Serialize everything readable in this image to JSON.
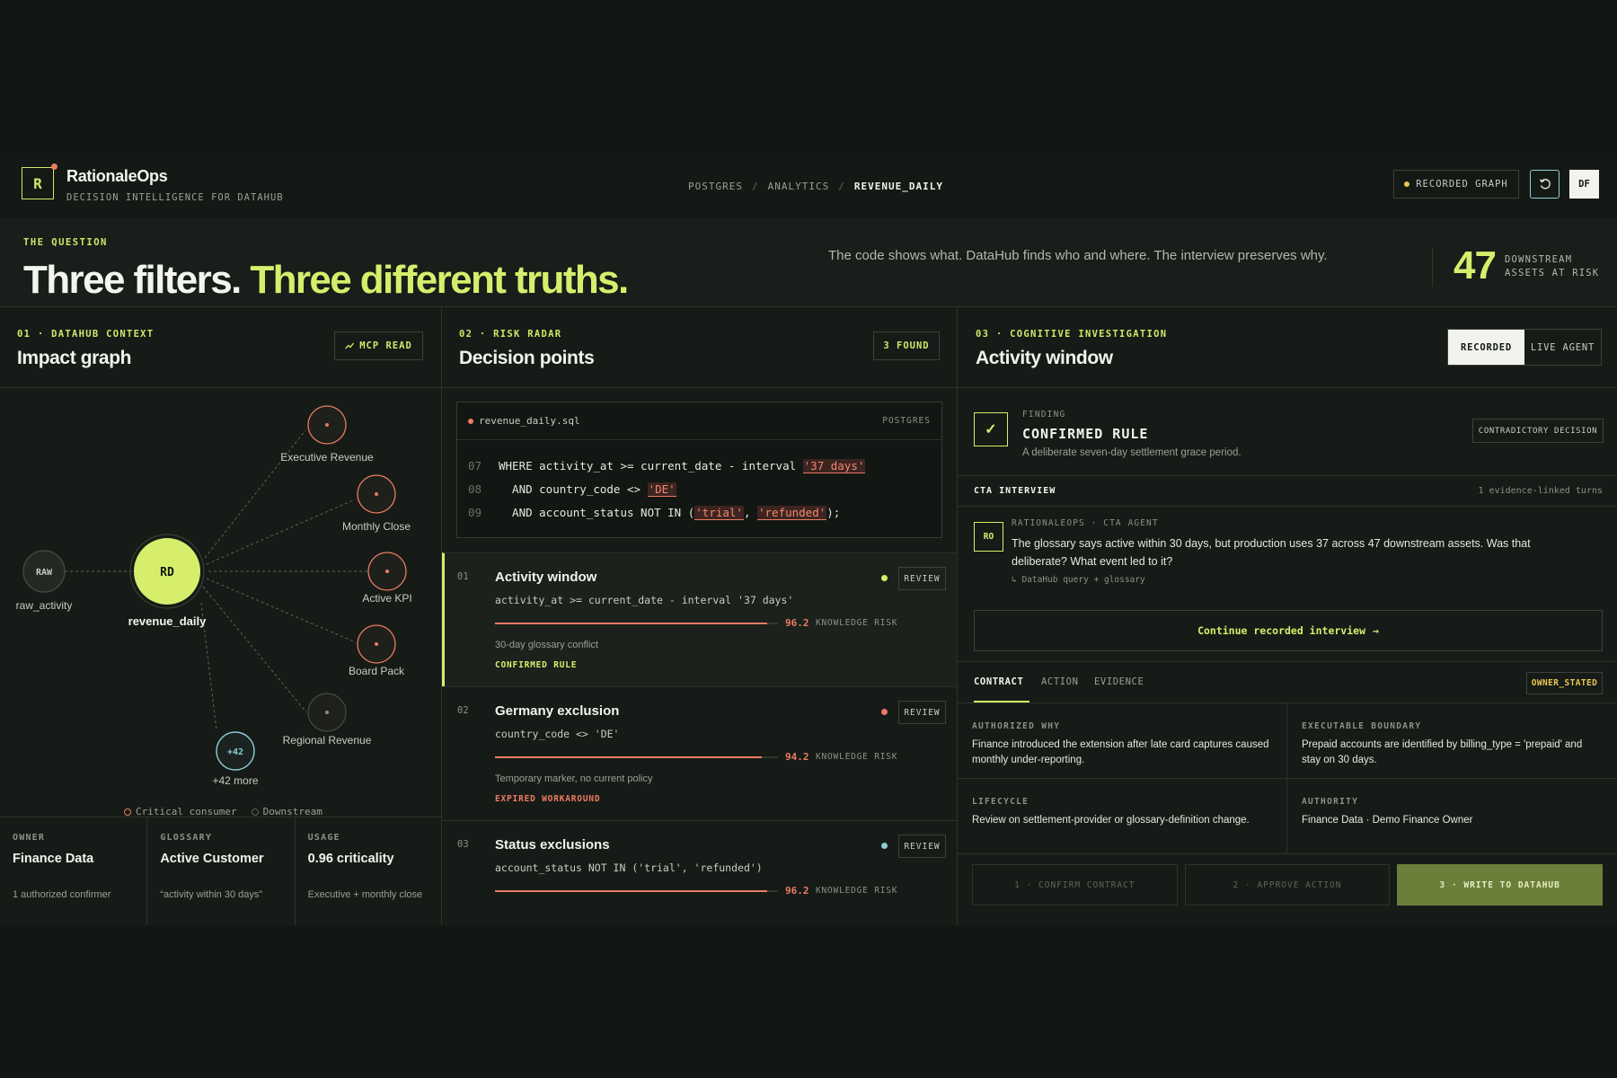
{
  "header": {
    "logo_letter": "R",
    "brand": "RationaleOps",
    "tagline": "DECISION INTELLIGENCE FOR DATAHUB",
    "breadcrumb": [
      "POSTGRES",
      "ANALYTICS",
      "REVENUE_DAILY"
    ],
    "breadcrumb_sep": "/",
    "recorded_graph": "RECORDED GRAPH",
    "avatar": "DF",
    "refresh_icon": "refresh-icon"
  },
  "question": {
    "label": "THE QUESTION",
    "title_a": "Three filters.",
    "title_b": "Three different truths.",
    "description": "The code shows what. DataHub finds who and where. The interview preserves why.",
    "count": "47",
    "count_label_1": "DOWNSTREAM",
    "count_label_2": "ASSETS AT RISK"
  },
  "impact": {
    "label": "01 · DATAHUB CONTEXT",
    "title": "Impact graph",
    "button": "MCP READ",
    "button_icon": "trend-icon",
    "source": {
      "badge": "RAW",
      "label": "raw_activity"
    },
    "center": {
      "badge": "RD",
      "label": "revenue_daily"
    },
    "nodes": [
      {
        "label": "Executive Revenue",
        "critical": true
      },
      {
        "label": "Monthly Close",
        "critical": true
      },
      {
        "label": "Active KPI",
        "critical": true
      },
      {
        "label": "Board Pack",
        "critical": true
      },
      {
        "label": "Regional Revenue",
        "critical": false
      }
    ],
    "more": {
      "badge": "+42",
      "label": "+42 more"
    },
    "legend_critical": "Critical consumer",
    "legend_downstream": "Downstream",
    "stats": [
      {
        "label": "OWNER",
        "value": "Finance Data",
        "sub": "1 authorized confirmer"
      },
      {
        "label": "GLOSSARY",
        "value": "Active Customer",
        "sub": "“activity within 30 days”"
      },
      {
        "label": "USAGE",
        "value": "0.96 criticality",
        "sub": "Executive + monthly close"
      }
    ]
  },
  "risk": {
    "label": "02 · RISK RADAR",
    "title": "Decision points",
    "badge": "3 FOUND",
    "code": {
      "file": "revenue_daily.sql",
      "lang": "POSTGRES",
      "lines": [
        {
          "n": "07",
          "pre": "WHERE activity_at >= current_date - interval ",
          "s1": "'37 days'",
          "mid": "",
          "s2": "",
          "post": ""
        },
        {
          "n": "08",
          "pre": "  AND country_code <> ",
          "s1": "'DE'",
          "mid": "",
          "s2": "",
          "post": ""
        },
        {
          "n": "09",
          "pre": "  AND account_status NOT IN (",
          "s1": "'trial'",
          "mid": ", ",
          "s2": "'refunded'",
          "post": ");"
        }
      ]
    },
    "items": [
      {
        "num": "01",
        "title": "Activity window",
        "code": "activity_at >= current_date - interval '37 days'",
        "score": "96.2",
        "score_pct": 96.2,
        "risk_label": "KNOWLEDGE RISK",
        "note": "30-day glossary conflict",
        "tag": "CONFIRMED RULE",
        "tag_color": "#d6ee6c",
        "dot": "#d6ee6c",
        "review": "REVIEW"
      },
      {
        "num": "02",
        "title": "Germany exclusion",
        "code": "country_code <> 'DE'",
        "score": "94.2",
        "score_pct": 94.2,
        "risk_label": "KNOWLEDGE RISK",
        "note": "Temporary marker, no current policy",
        "tag": "EXPIRED WORKAROUND",
        "tag_color": "#ec7b62",
        "dot": "#ec7b62",
        "review": "REVIEW"
      },
      {
        "num": "03",
        "title": "Status exclusions",
        "code": "account_status NOT IN ('trial', 'refunded')",
        "score": "96.2",
        "score_pct": 96.2,
        "risk_label": "KNOWLEDGE RISK",
        "note": "",
        "tag": "",
        "tag_color": "#d6ee6c",
        "dot": "#8ecdd8",
        "review": "REVIEW"
      }
    ]
  },
  "investigation": {
    "label": "03 · COGNITIVE INVESTIGATION",
    "title": "Activity window",
    "toggle": [
      "RECORDED",
      "LIVE AGENT"
    ],
    "finding": {
      "label": "FINDING",
      "title": "CONFIRMED RULE",
      "sub": "A deliberate seven-day settlement grace period.",
      "button": "CONTRADICTORY DECISION",
      "check": "✓"
    },
    "interview": {
      "title": "CTA INTERVIEW",
      "count": "1 evidence-linked turns",
      "avatar": "RO",
      "who": "RATIONALEOPS · CTA AGENT",
      "text": "The glossary says active within 30 days, but production uses 37 across 47 downstream assets. Was that deliberate? What event led to it?",
      "source": "↳ DataHub query + glossary",
      "continue": "Continue recorded interview",
      "arrow": "→"
    },
    "tabs": [
      "CONTRACT",
      "ACTION",
      "EVIDENCE"
    ],
    "owner_badge": "OWNER_STATED",
    "contract": [
      {
        "label": "AUTHORIZED WHY",
        "value": "Finance introduced the extension after late card captures caused monthly under-reporting."
      },
      {
        "label": "EXECUTABLE BOUNDARY",
        "value": "Prepaid accounts are identified by billing_type = 'prepaid' and stay on 30 days."
      },
      {
        "label": "LIFECYCLE",
        "value": "Review on settlement-provider or glossary-definition change."
      },
      {
        "label": "AUTHORITY",
        "value": "Finance Data · Demo Finance Owner"
      }
    ],
    "steps": [
      "1 · CONFIRM CONTRACT",
      "2 · APPROVE ACTION",
      "3 · WRITE TO DATAHUB"
    ]
  }
}
